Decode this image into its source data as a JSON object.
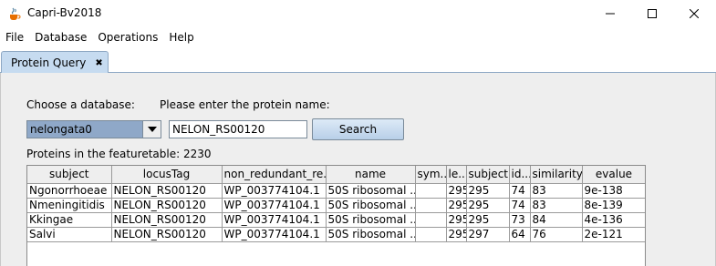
{
  "window": {
    "title": "Capri-Bv2018"
  },
  "menu": [
    {
      "label": "File"
    },
    {
      "label": "Database"
    },
    {
      "label": "Operations"
    },
    {
      "label": "Help"
    }
  ],
  "tab": {
    "label": "Protein Query",
    "close_glyph": "✖"
  },
  "form": {
    "choose_db_label": "Choose a database:",
    "protein_name_label": "Please enter the protein name:",
    "database_selected": "nelongata0",
    "protein_name_value": "NELON_RS00120",
    "search_label": "Search",
    "proteins_count_text": "Proteins in the featuretable: 2230"
  },
  "table": {
    "columns": [
      "subject",
      "locusTag",
      "non_redundant_re...",
      "name",
      "sym...",
      "le...",
      "subject...",
      "id...",
      "similarity",
      "evalue"
    ],
    "rows": [
      [
        "Ngonorrhoeae",
        "NELON_RS00120",
        "WP_003774104.1",
        "50S ribosomal ...",
        "",
        "295",
        "295",
        "74",
        "83",
        "9e-138"
      ],
      [
        "Nmeningitidis",
        "NELON_RS00120",
        "WP_003774104.1",
        "50S ribosomal ...",
        "",
        "295",
        "295",
        "74",
        "83",
        "8e-139"
      ],
      [
        "Kkingae",
        "NELON_RS00120",
        "WP_003774104.1",
        "50S ribosomal ...",
        "",
        "295",
        "295",
        "73",
        "84",
        "4e-136"
      ],
      [
        "Salvi",
        "NELON_RS00120",
        "WP_003774104.1",
        "50S ribosomal ...",
        "",
        "295",
        "297",
        "64",
        "76",
        "2e-121"
      ]
    ]
  },
  "icons": {
    "app": "java-cup-icon",
    "minimize": "minimize-icon",
    "maximize": "maximize-icon",
    "close": "close-icon",
    "dropdown": "chevron-down-icon"
  },
  "colors": {
    "tab_bg": "#c6dbf0",
    "combo_selected_bg": "#8fa8c8",
    "button_gradient_top": "#ddeaf7",
    "button_gradient_bottom": "#b8cfe8",
    "panel_bg": "#eeeeee"
  }
}
